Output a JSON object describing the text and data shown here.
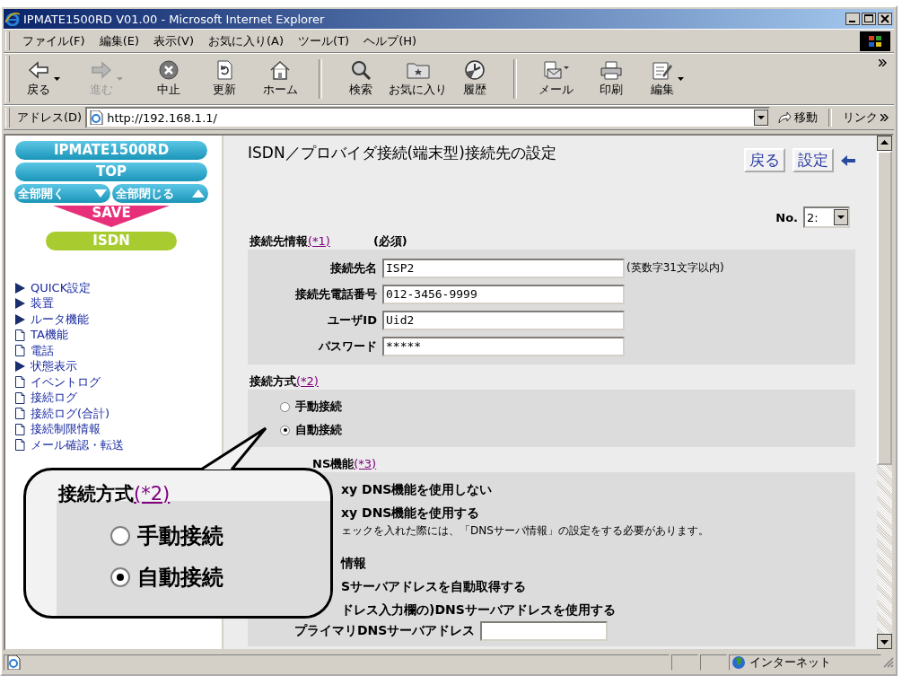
{
  "window": {
    "title": "IPMATE1500RD V01.00 - Microsoft Internet Explorer"
  },
  "menu": [
    "ファイル(F)",
    "編集(E)",
    "表示(V)",
    "お気に入り(A)",
    "ツール(T)",
    "ヘルプ(H)"
  ],
  "toolbar": [
    [
      {
        "label": "戻る",
        "kind": "back",
        "disabled": false,
        "dropdown": true
      },
      {
        "label": "進む",
        "kind": "forward",
        "disabled": true,
        "dropdown": true
      },
      {
        "label": "中止",
        "kind": "stop",
        "disabled": false,
        "dropdown": false
      },
      {
        "label": "更新",
        "kind": "refresh",
        "disabled": false,
        "dropdown": false
      },
      {
        "label": "ホーム",
        "kind": "home",
        "disabled": false,
        "dropdown": false
      }
    ],
    [
      {
        "label": "検索",
        "kind": "search",
        "disabled": false,
        "dropdown": false
      },
      {
        "label": "お気に入り",
        "kind": "favorites",
        "disabled": false,
        "dropdown": false
      },
      {
        "label": "履歴",
        "kind": "history",
        "disabled": false,
        "dropdown": false
      }
    ],
    [
      {
        "label": "メール",
        "kind": "mail",
        "disabled": false,
        "dropdown": false
      },
      {
        "label": "印刷",
        "kind": "print",
        "disabled": false,
        "dropdown": false
      },
      {
        "label": "編集",
        "kind": "edit",
        "disabled": false,
        "dropdown": true
      }
    ]
  ],
  "address": {
    "label": "アドレス(D)",
    "value": "http://192.168.1.1/",
    "go": "移動",
    "links": "リンク"
  },
  "sidebar": {
    "banners": [
      {
        "label": "IPMATE1500RD",
        "kind": "pill"
      },
      {
        "label": "TOP",
        "kind": "pill"
      },
      {
        "label": "全部開く",
        "kind": "expand"
      },
      {
        "label": "全部閉じる",
        "kind": "collapse"
      },
      {
        "label": "SAVE",
        "kind": "save"
      },
      {
        "label": "ISDN",
        "kind": "mode"
      }
    ],
    "items": [
      {
        "label": "QUICK設定",
        "kind": "folder"
      },
      {
        "label": "装置",
        "kind": "folder"
      },
      {
        "label": "ルータ機能",
        "kind": "folder"
      },
      {
        "label": "TA機能",
        "kind": "page"
      },
      {
        "label": "電話",
        "kind": "page"
      },
      {
        "label": "状態表示",
        "kind": "folder"
      },
      {
        "label": "イベントログ",
        "kind": "page"
      },
      {
        "label": "接続ログ",
        "kind": "page"
      },
      {
        "label": "接続ログ(合計)",
        "kind": "page"
      },
      {
        "label": "接続制限情報",
        "kind": "page"
      },
      {
        "label": "メール確認・転送",
        "kind": "page"
      }
    ]
  },
  "page": {
    "title": "ISDN／プロバイダ接続(端末型)接続先の設定",
    "buttons": [
      "戻る",
      "設定"
    ],
    "number": {
      "label": "No.",
      "value": "2:"
    },
    "sections": [
      {
        "kind": "fields",
        "heading": "接続先情報",
        "note": "(*1)",
        "extra": "(必須)",
        "fields": [
          {
            "label": "接続先名",
            "value": "ISP2",
            "hint": "(英数字31文字以内)"
          },
          {
            "label": "接続先電話番号",
            "value": "012-3456-9999"
          },
          {
            "label": "ユーザID",
            "value": "Uid2"
          },
          {
            "label": "パスワード",
            "value": "*****"
          }
        ]
      },
      {
        "kind": "radios",
        "heading": "接続方式",
        "note": "(*2)",
        "options": [
          {
            "label": "手動接続",
            "selected": false
          },
          {
            "label": "自動接続",
            "selected": true
          }
        ]
      },
      {
        "kind": "partial",
        "heading": "NS機能",
        "note": "(*3)",
        "lines": [
          {
            "kind": "option",
            "text": "xy DNS機能を使用しない"
          },
          {
            "kind": "option",
            "text": "xy DNS機能を使用する"
          },
          {
            "kind": "hint",
            "text": "ェックを入れた際には、「DNSサーバ情報」の設定をする必要があります。"
          },
          {
            "kind": "heading",
            "text": "情報"
          },
          {
            "kind": "option",
            "text": "Sサーバアドレスを自動取得する"
          },
          {
            "kind": "option",
            "text": "ドレス入力欄の)DNSサーバアドレスを使用する"
          },
          {
            "kind": "field",
            "text": "プライマリDNSサーバアドレス"
          }
        ]
      }
    ]
  },
  "callout": {
    "heading": "接続方式",
    "note": "(*2)",
    "options": [
      {
        "label": "手動接続",
        "selected": false
      },
      {
        "label": "自動接続",
        "selected": true
      }
    ]
  },
  "status_bar": {
    "zone": "インターネット"
  }
}
